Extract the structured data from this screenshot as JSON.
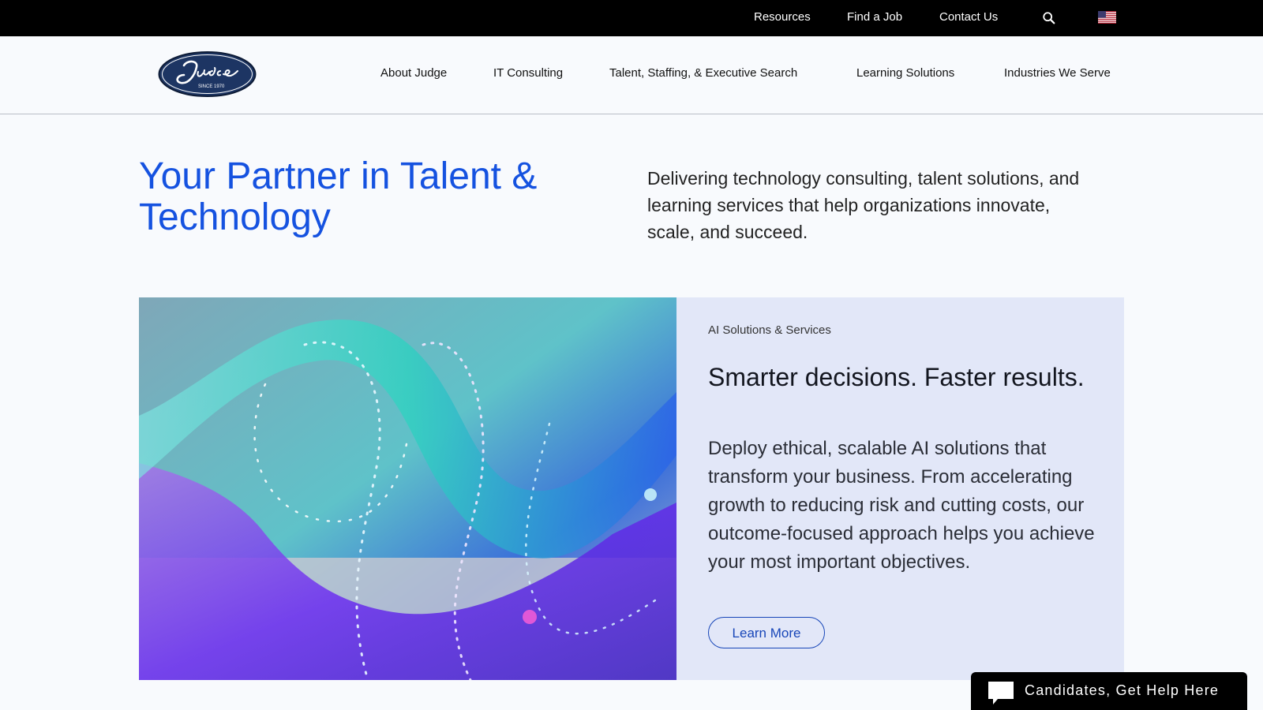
{
  "topbar": {
    "links": [
      "Resources",
      "Find a Job",
      "Contact Us"
    ],
    "search_icon": "search-icon",
    "flag_icon": "us-flag-icon"
  },
  "header": {
    "logo_text": "Judge",
    "logo_subtext": "SINCE 1970",
    "nav": [
      "About Judge",
      "IT Consulting",
      "Talent, Staffing, & Executive Search",
      "Learning Solutions",
      "Industries We Serve"
    ]
  },
  "hero": {
    "title": "Your Partner in Talent & Technology",
    "description": "Delivering technology consulting, talent solutions, and learning services that help organizations innovate, scale, and succeed."
  },
  "feature": {
    "eyebrow": "AI Solutions & Services",
    "title": "Smarter decisions. Faster results.",
    "body": "Deploy ethical, scalable AI solutions that transform your business. From accelerating growth to reducing risk and cutting costs, our outcome-focused approach helps you achieve your most important objectives.",
    "button": "Learn More"
  },
  "chat_widget": {
    "label": "Candidates, Get Help Here",
    "icon": "chat-bubble-icon"
  },
  "colors": {
    "brand_blue": "#1552e0",
    "button_blue": "#1746b8",
    "panel_bg": "#e2e7f8",
    "topbar_bg": "#000000"
  }
}
